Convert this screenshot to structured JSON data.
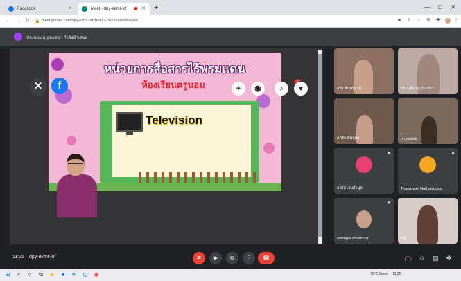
{
  "browser": {
    "tabs": [
      {
        "label": "Facebook",
        "active": false,
        "favicon_color": "#1877f2"
      },
      {
        "label": "Meet - dpy-ekmt-iof",
        "active": true,
        "favicon_color": "#00897b"
      }
    ],
    "url": "meet.google.com/dpy-ekmt-iof?hs=122&authuser=0&pli=1"
  },
  "meet": {
    "presenter_text": "ประนอม บุญระเสนา กำลังนำเสนอ",
    "slide": {
      "title": "หน่วยการสื่อสารไร้พรมแดน",
      "subtitle": "ห้องเรียนครูนอม",
      "card_label": "Television"
    },
    "notification_count": "2",
    "participants": [
      {
        "name": "อรัส จันทรนาม",
        "type": "video"
      },
      {
        "name": "ประนอม บุญระเสนา",
        "type": "video"
      },
      {
        "name": "อภิรัล ตันบุทธ",
        "type": "video"
      },
      {
        "name": "tm mobile",
        "type": "video"
      },
      {
        "name": "สงกัส เจนกำนุล",
        "type": "avatar",
        "avatar_color": "#e84070"
      },
      {
        "name": "Thanaporn Hathaisodsai",
        "type": "avatar",
        "avatar_color": "#f5a623"
      },
      {
        "name": "witthaya chuanchit",
        "type": "video"
      },
      {
        "name": "Pill",
        "type": "video"
      }
    ],
    "time": "11:25",
    "meeting_code": "dpy-ekmt-iof"
  },
  "taskbar": {
    "weather": "30°C Sunny",
    "clock": "11:25"
  },
  "colors": {
    "meet_bg": "#202124",
    "red": "#ea4335",
    "fb": "#1877f2"
  }
}
